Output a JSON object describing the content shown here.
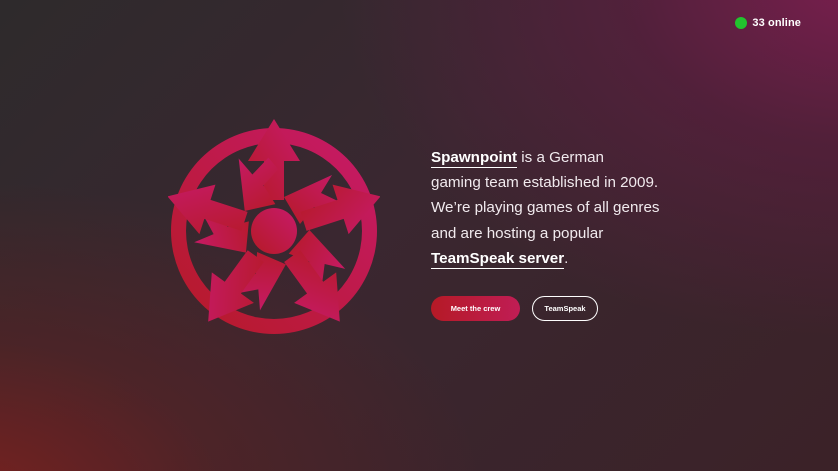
{
  "status": {
    "online_label": "33 online",
    "indicator_color": "#22c32e"
  },
  "logo": {
    "icon": "spawnpoint-logo-icon",
    "gradient": [
      "#b51a26",
      "#c71a6a"
    ]
  },
  "intro": {
    "brand_link": "Spawnpoint",
    "line1_rest": " is a German",
    "line2": "gaming team established in 2009.",
    "line3": "We’re playing games of all genres",
    "line4": "and are hosting a popular",
    "server_link": "TeamSpeak server",
    "server_suffix": "."
  },
  "buttons": {
    "primary_label": "Meet the crew",
    "secondary_label": "TeamSpeak"
  },
  "colors": {
    "accent_start": "#b51a26",
    "accent_end": "#c01d55"
  }
}
